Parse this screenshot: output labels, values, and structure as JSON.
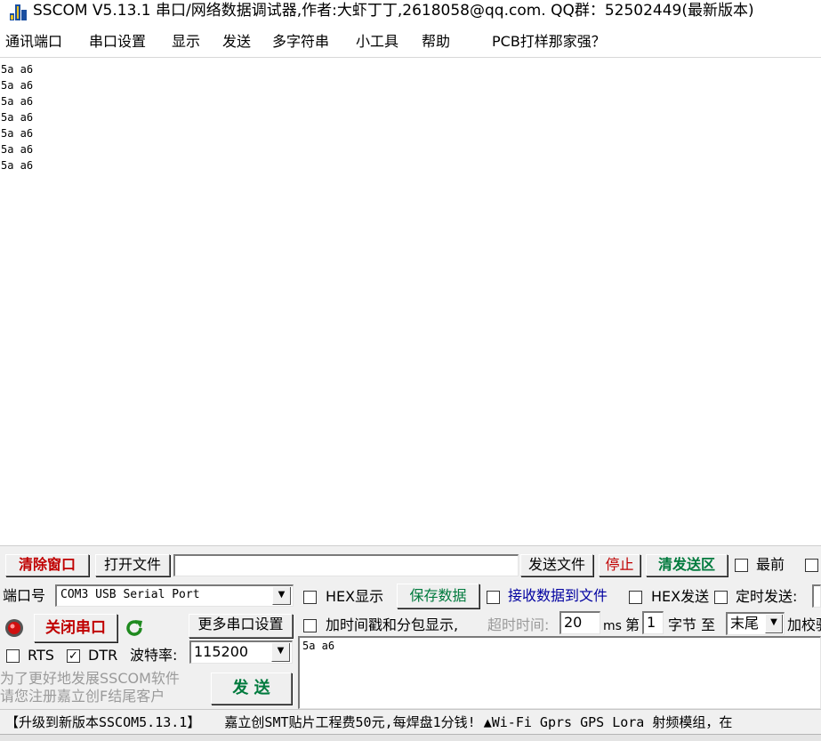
{
  "window": {
    "title": "SSCOM V5.13.1 串口/网络数据调试器,作者:大虾丁丁,2618058@qq.com. QQ群：52502449(最新版本)"
  },
  "menu": [
    "通讯端口",
    "串口设置",
    "显示",
    "发送",
    "多字符串",
    "小工具",
    "帮助",
    "PCB打样那家强？"
  ],
  "receive": {
    "lines": [
      "5a a6",
      "5a a6",
      "5a a6",
      "5a a6",
      "5a a6",
      "5a a6",
      "5a a6"
    ]
  },
  "toolbar": {
    "clear_window": "清除窗口",
    "open_file": "打开文件",
    "file_path": "",
    "send_file": "发送文件",
    "stop": "停止",
    "clear_send": "清发送区",
    "last_label": "最前"
  },
  "port": {
    "label": "端口号",
    "value": "COM3 USB Serial Port",
    "close_port": "关闭串口",
    "more_settings": "更多串口设置",
    "rts": "RTS",
    "dtr": "DTR",
    "rts_checked": false,
    "dtr_checked": true,
    "baud_label": "波特率:",
    "baud_value": "115200"
  },
  "options": {
    "hex_display": "HEX显示",
    "save_data": "保存数据",
    "recv_to_file": "接收数据到文件",
    "hex_send": "HEX发送",
    "timed_send": "定时发送:",
    "timestamp": "加时间戳和分包显示,",
    "timeout_label": "超时时间:",
    "timeout_value": "20",
    "ms": "ms",
    "di": "第",
    "byte_index": "1",
    "byte_to": "字节 至",
    "end_value": "末尾",
    "checksum": "加校验"
  },
  "promo": {
    "line1": "为了更好地发展SSCOM软件",
    "line2": "请您注册嘉立创F结尾客户"
  },
  "send": {
    "text": "5a a6",
    "button": "发 送"
  },
  "status": {
    "text": "【升级到新版本SSCOM5.13.1】   嘉立创SMT贴片工程费50元,每焊盘1分钱! ▲Wi-Fi Gprs GPS Lora 射频模组，在"
  },
  "colors": {
    "red_button_text": "#c00000",
    "green_button_text": "#007a3d",
    "blue_label_text": "#0000a0",
    "disabled_text": "#9a9a9a"
  }
}
